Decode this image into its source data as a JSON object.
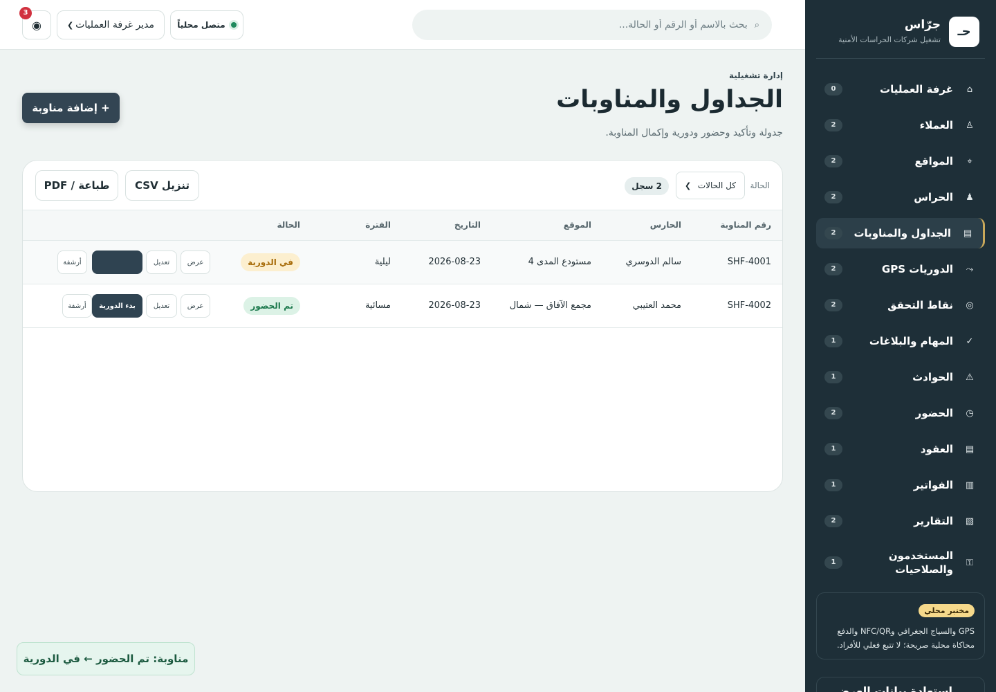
{
  "app": {
    "brand_name": "جرّاس",
    "brand_subtitle": "تشغيل شركات الحراسات الأمنية",
    "logo_text": "حـ"
  },
  "topbar": {
    "search_placeholder": "بحث بالاسم أو الرقم أو الحالة...",
    "search_icon": "search-icon",
    "status_text": "متصل محلياً",
    "role_value": "مدير غرفة العمليات",
    "theme_icon": "contrast-icon",
    "notifications_count": "3"
  },
  "sidebar": {
    "items": [
      {
        "label": "غرفة العمليات",
        "count": "0",
        "icon": "⌂",
        "icon_name": "home-icon"
      },
      {
        "label": "العملاء",
        "count": "2",
        "icon": "♙",
        "icon_name": "clients-icon"
      },
      {
        "label": "المواقع",
        "count": "2",
        "icon": "⌖",
        "icon_name": "location-icon"
      },
      {
        "label": "الحراس",
        "count": "2",
        "icon": "♟",
        "icon_name": "guard-icon"
      },
      {
        "label": "الجداول والمناوبات",
        "count": "2",
        "icon": "▤",
        "icon_name": "schedule-icon",
        "active": true
      },
      {
        "label": "الدوريات GPS",
        "count": "2",
        "icon": "⤳",
        "icon_name": "route-icon"
      },
      {
        "label": "نقاط التحقق",
        "count": "2",
        "icon": "◎",
        "icon_name": "checkpoint-icon"
      },
      {
        "label": "المهام والبلاغات",
        "count": "1",
        "icon": "✓",
        "icon_name": "check-icon"
      },
      {
        "label": "الحوادث",
        "count": "1",
        "icon": "⚠",
        "icon_name": "warning-icon"
      },
      {
        "label": "الحضور",
        "count": "2",
        "icon": "◷",
        "icon_name": "clock-icon"
      },
      {
        "label": "العقود",
        "count": "1",
        "icon": "▤",
        "icon_name": "contract-icon"
      },
      {
        "label": "الفواتير",
        "count": "1",
        "icon": "▥",
        "icon_name": "invoice-icon"
      },
      {
        "label": "التقارير",
        "count": "2",
        "icon": "▧",
        "icon_name": "report-icon"
      },
      {
        "label": "المستخدمون والصلاحيات",
        "count": "1",
        "icon": "⚿",
        "icon_name": "key-icon"
      }
    ],
    "lab_badge": "مختبر محلي",
    "lab_line1": "GPS والسياج الجغرافي وNFC/QR والدفع",
    "lab_line2": "محاكاة محلية صريحة؛ لا تتبع فعلي للأفراد.",
    "restore_title": "استعادة بيانات العرض"
  },
  "page": {
    "eyebrow": "إدارة تشغيلية",
    "title": "الجداول والمناوبات",
    "subtitle": "جدولة وتأكيد وحضور ودورية وإكمال المناوبة.",
    "add_button": "+ إضافة مناوبة"
  },
  "toolbar": {
    "filter_label": "الحالة",
    "filter_value": "كل الحالات",
    "record_count": "2 سجل",
    "csv_button": "تنزيل CSV",
    "pdf_button": "طباعة / PDF"
  },
  "table": {
    "columns": [
      "رقم المناوبة",
      "الحارس",
      "الموقع",
      "التاريخ",
      "الفترة",
      "الحالة"
    ],
    "rows": [
      {
        "id": "SHF-4001",
        "guard": "سالم الدوسري",
        "site": "مستودع المدى 4",
        "date": "2026-08-23",
        "shift": "ليلية",
        "status": "في الدورية",
        "view": "عرض",
        "edit": "تعديل",
        "start": "",
        "archive": "أرشفة"
      },
      {
        "id": "SHF-4002",
        "guard": "محمد العتيبي",
        "site": "مجمع الآفاق — شمال",
        "date": "2026-08-23",
        "shift": "مسائية",
        "status": "تم الحضور",
        "view": "عرض",
        "edit": "تعديل",
        "start": "بدء الدورية",
        "archive": "أرشفة"
      }
    ]
  },
  "toast": {
    "message": "مناوبة: تم الحضور ← في الدورية"
  },
  "colors": {
    "sidebar_bg": "#1e2f38",
    "accent_gold": "#c9a85a",
    "primary_button": "#334553",
    "status_online": "#1f8a5d",
    "badge_warn": "#a86d0b",
    "badge_ok": "#1e7a4e"
  }
}
